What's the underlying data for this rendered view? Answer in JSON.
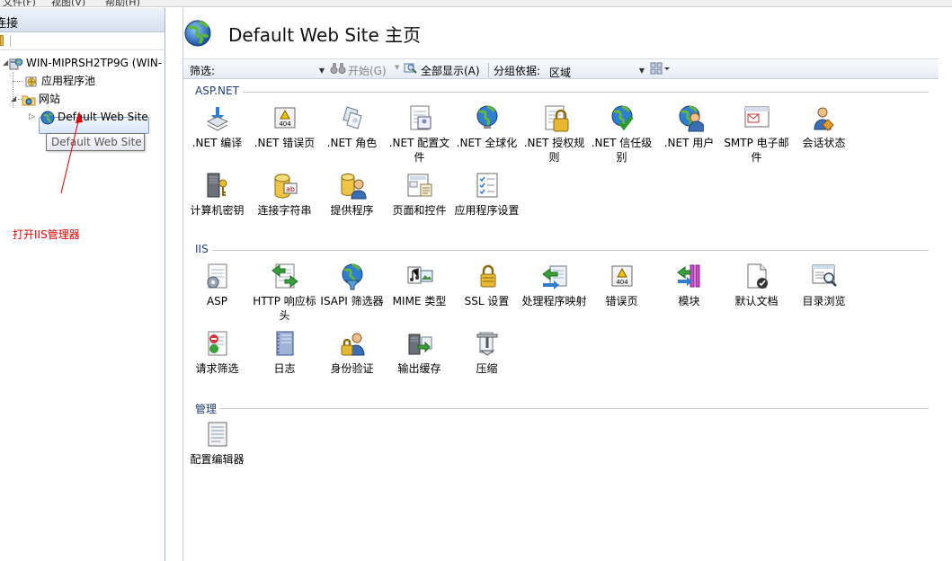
{
  "menubar": {
    "items": [
      "文件(F)",
      "视图(V)",
      "帮助(H)"
    ]
  },
  "left": {
    "header": "连接",
    "tree": {
      "server": "WIN-MIPRSH2TP9G (WIN-",
      "app_pools": "应用程序池",
      "sites": "网站",
      "default_site": "Default Web Site"
    },
    "tooltip": "Default Web Site",
    "annotation": "打开IIS管理器"
  },
  "main": {
    "title": "Default Web Site 主页",
    "filter": {
      "label": "筛选:",
      "value": "",
      "start_label": "开始(G)",
      "show_all_label": "全部显示(A)",
      "group_by_label": "分组依据:",
      "group_by_value": "区域"
    },
    "sections": [
      {
        "title": "ASP.NET",
        "items": [
          {
            "label": ".NET 编译",
            "icon": "net-compilation-icon"
          },
          {
            "label": ".NET 错误页",
            "icon": "net-error-pages-icon"
          },
          {
            "label": ".NET 角色",
            "icon": "net-roles-icon"
          },
          {
            "label": ".NET 配置文件",
            "icon": "net-profile-icon"
          },
          {
            "label": ".NET 全球化",
            "icon": "net-globalization-icon"
          },
          {
            "label": ".NET 授权规则",
            "icon": "net-authorization-icon"
          },
          {
            "label": ".NET 信任级别",
            "icon": "net-trust-levels-icon"
          },
          {
            "label": ".NET 用户",
            "icon": "net-users-icon"
          },
          {
            "label": "SMTP 电子邮件",
            "icon": "smtp-email-icon"
          },
          {
            "label": "会话状态",
            "icon": "session-state-icon"
          },
          {
            "label": "计算机密钥",
            "icon": "machine-key-icon"
          },
          {
            "label": "连接字符串",
            "icon": "connection-strings-icon"
          },
          {
            "label": "提供程序",
            "icon": "providers-icon"
          },
          {
            "label": "页面和控件",
            "icon": "pages-controls-icon"
          },
          {
            "label": "应用程序设置",
            "icon": "app-settings-icon"
          }
        ]
      },
      {
        "title": "IIS",
        "items": [
          {
            "label": "ASP",
            "icon": "asp-icon"
          },
          {
            "label": "HTTP 响应标头",
            "icon": "http-response-headers-icon"
          },
          {
            "label": "ISAPI 筛选器",
            "icon": "isapi-filters-icon"
          },
          {
            "label": "MIME 类型",
            "icon": "mime-types-icon"
          },
          {
            "label": "SSL 设置",
            "icon": "ssl-settings-icon"
          },
          {
            "label": "处理程序映射",
            "icon": "handler-mappings-icon"
          },
          {
            "label": "错误页",
            "icon": "error-pages-icon"
          },
          {
            "label": "模块",
            "icon": "modules-icon"
          },
          {
            "label": "默认文档",
            "icon": "default-document-icon"
          },
          {
            "label": "目录浏览",
            "icon": "directory-browsing-icon"
          },
          {
            "label": "请求筛选",
            "icon": "request-filtering-icon"
          },
          {
            "label": "日志",
            "icon": "logging-icon"
          },
          {
            "label": "身份验证",
            "icon": "authentication-icon"
          },
          {
            "label": "输出缓存",
            "icon": "output-caching-icon"
          },
          {
            "label": "压缩",
            "icon": "compression-icon"
          }
        ]
      },
      {
        "title": "管理",
        "items": [
          {
            "label": "配置编辑器",
            "icon": "configuration-editor-icon"
          }
        ]
      }
    ]
  }
}
